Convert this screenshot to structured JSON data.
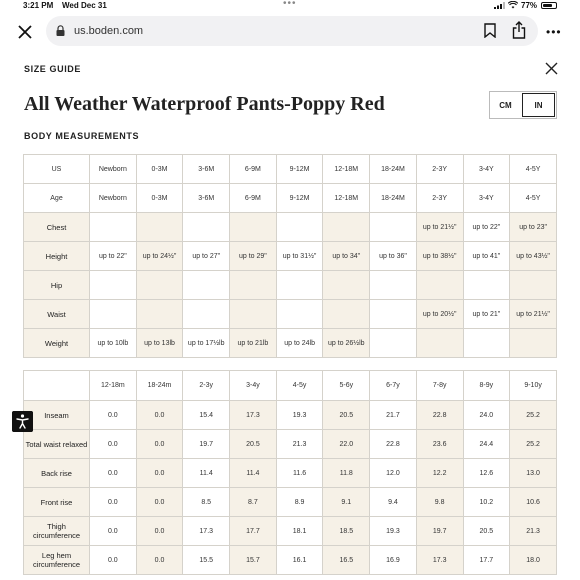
{
  "status_bar": {
    "time": "3:21 PM",
    "date": "Wed Dec 31",
    "battery": "77%"
  },
  "browser": {
    "url": "us.boden.com"
  },
  "modal": {
    "label": "SIZE GUIDE",
    "title": "All Weather Waterproof Pants-Poppy Red",
    "units": [
      "CM",
      "IN"
    ],
    "selected_unit": "IN",
    "section_title": "BODY MEASUREMENTS"
  },
  "table1": {
    "rows": [
      {
        "label": "US",
        "cells": [
          "Newborn",
          "0-3M",
          "3-6M",
          "6-9M",
          "9-12M",
          "12-18M",
          "18-24M",
          "2-3Y",
          "3-4Y",
          "4-5Y"
        ]
      },
      {
        "label": "Age",
        "cells": [
          "Newborn",
          "0-3M",
          "3-6M",
          "6-9M",
          "9-12M",
          "12-18M",
          "18-24M",
          "2-3Y",
          "3-4Y",
          "4-5Y"
        ]
      },
      {
        "label": "Chest",
        "cells": [
          "",
          "",
          "",
          "",
          "",
          "",
          "",
          "up to 21½\"",
          "up to 22\"",
          "up to 23\""
        ]
      },
      {
        "label": "Height",
        "cells": [
          "up to 22\"",
          "up to 24½\"",
          "up to 27\"",
          "up to 29\"",
          "up to 31½\"",
          "up to 34\"",
          "up to 36\"",
          "up to 38½\"",
          "up to 41\"",
          "up to 43½\""
        ]
      },
      {
        "label": "Hip",
        "cells": [
          "",
          "",
          "",
          "",
          "",
          "",
          "",
          "",
          "",
          ""
        ]
      },
      {
        "label": "Waist",
        "cells": [
          "",
          "",
          "",
          "",
          "",
          "",
          "",
          "up to 20½\"",
          "up to 21\"",
          "up to 21½\""
        ]
      },
      {
        "label": "Weight",
        "cells": [
          "up to 10lb",
          "up to 13lb",
          "up to 17½lb",
          "up to 21lb",
          "up to 24lb",
          "up to 26½lb",
          "",
          "",
          "",
          ""
        ]
      }
    ]
  },
  "table2": {
    "headers": [
      "12-18m",
      "18-24m",
      "2-3y",
      "3-4y",
      "4-5y",
      "5-6y",
      "6-7y",
      "7-8y",
      "8-9y",
      "9-10y"
    ],
    "rows": [
      {
        "label": "Inseam",
        "cells": [
          "0.0",
          "0.0",
          "15.4",
          "17.3",
          "19.3",
          "20.5",
          "21.7",
          "22.8",
          "24.0",
          "25.2"
        ]
      },
      {
        "label": "Total waist relaxed",
        "cells": [
          "0.0",
          "0.0",
          "19.7",
          "20.5",
          "21.3",
          "22.0",
          "22.8",
          "23.6",
          "24.4",
          "25.2"
        ]
      },
      {
        "label": "Back rise",
        "cells": [
          "0.0",
          "0.0",
          "11.4",
          "11.4",
          "11.6",
          "11.8",
          "12.0",
          "12.2",
          "12.6",
          "13.0"
        ]
      },
      {
        "label": "Front rise",
        "cells": [
          "0.0",
          "0.0",
          "8.5",
          "8.7",
          "8.9",
          "9.1",
          "9.4",
          "9.8",
          "10.2",
          "10.6"
        ]
      },
      {
        "label": "Thigh circumference",
        "cells": [
          "0.0",
          "0.0",
          "17.3",
          "17.7",
          "18.1",
          "18.5",
          "19.3",
          "19.7",
          "20.5",
          "21.3"
        ]
      },
      {
        "label": "Leg hem circumference",
        "cells": [
          "0.0",
          "0.0",
          "15.5",
          "15.7",
          "16.1",
          "16.5",
          "16.9",
          "17.3",
          "17.7",
          "18.0"
        ]
      }
    ]
  }
}
